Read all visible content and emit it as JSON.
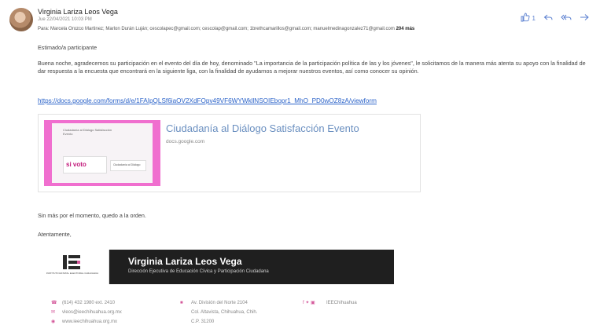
{
  "header": {
    "sender": "Virginia Lariza Leos Vega",
    "date": "Jue 22/04/2021 10:03 PM",
    "to_prefix": "Para:",
    "to_list": "Marcela Orozco Martinez; Marlon Durán Luján; cescolapec@gmail.com; cescolap@gmail.com; 1brethcamarillos@gmail.com; manuelmedinagonzalez71@gmail.com",
    "more": "204 más",
    "actions": {
      "like_icon": "thumbs-up-icon",
      "like_count": "1",
      "reply_icon": "reply-icon",
      "reply_all_icon": "reply-all-icon",
      "forward_icon": "forward-icon"
    }
  },
  "body": {
    "greeting": "Estimado/a participante",
    "paragraph": "Buena noche, agradecemos su participación en el evento del día de hoy, denominado \"La importancia de la participación política de las y los jóvenes\", le solicitamos de la manera más atenta su apoyo con la finalidad de dar respuesta a la encuesta que encontrará en la siguiente liga, con la finalidad de ayudarnos a mejorar nuestros eventos, así como conocer su opinión.",
    "link": "https://docs.google.com/forms/d/e/1FAIpQLSf6iaOV2XdFOpv49VF6WYWkllNSOIEbopr1_MhO_PD0wOZ8zA/viewform",
    "preview": {
      "title": "Ciudadanía al Diálogo Satisfacción Evento",
      "domain": "docs.google.com",
      "thumb_title": "Ciudadanía al Diálogo Satisfacción Evento",
      "thumb_logo": "si voto",
      "thumb_badge": "Ciudadanía al Diálogo"
    },
    "closing": "Sin más por el momento, quedo a la orden.",
    "regards": "Atentamente,"
  },
  "signature": {
    "logo_caption": "INSTITUTO ESTATAL ELECTORAL CHIHUAHUA",
    "name": "Virginia Lariza Leos  Vega",
    "role": "Dirección Ejecutiva de Educación Cívica y Participación Ciudadana",
    "phone": "(614) 432 1980 ext. 2410",
    "email": "vleos@ieechihuahua.org.mx",
    "web": "www.ieechihuahua.org.mx",
    "address1": "Av. División del Norte 2104",
    "address2": "Col. Altavista, Chihuahua, Chih.",
    "address3": "C.P. 31200",
    "social": "IEEChihuahua",
    "accent": "#d4589a"
  }
}
